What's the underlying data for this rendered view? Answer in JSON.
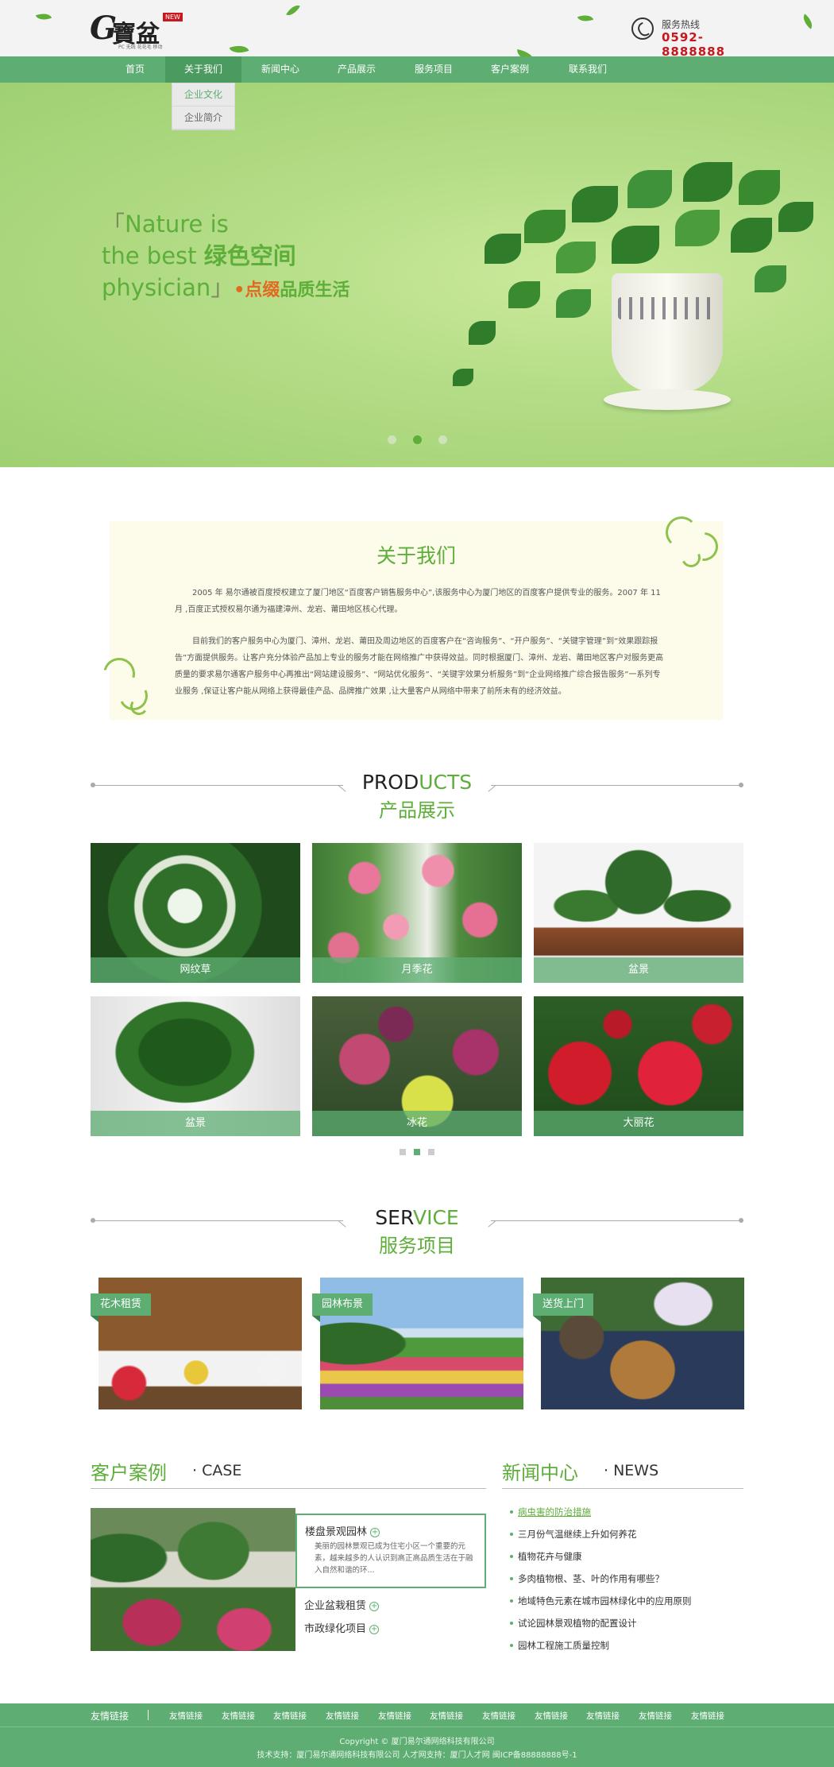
{
  "header": {
    "logo_letter": "G",
    "logo_cn": "寶盆",
    "logo_badge": "NEW",
    "logo_sub": "PC 无线 花花毛 移动",
    "hotline_label": "服务热线",
    "hotline_number": "0592-8888888"
  },
  "nav": {
    "items": [
      "首页",
      "关于我们",
      "新闻中心",
      "产品展示",
      "服务项目",
      "客户案例",
      "联系我们"
    ],
    "dropdown": [
      "企业文化",
      "企业简介"
    ]
  },
  "banner": {
    "line1": "Nature is",
    "line2_en": "the best ",
    "line2_cn": "绿色空间",
    "line3_en": "physician",
    "tag_dot": "•",
    "tag_orange": "点缀",
    "tag_green": "品质生活",
    "slides": 3,
    "active_slide": 2
  },
  "about": {
    "title": "关于我们",
    "p1": "2005 年 易尔通被百度授权建立了厦门地区“百度客户销售服务中心”,该服务中心为厦门地区的百度客户提供专业的服务。2007 年 11 月 ,百度正式授权易尔通为福建漳州、龙岩、莆田地区核心代理。",
    "p2": "目前我们的客户服务中心为厦门、漳州、龙岩、莆田及周边地区的百度客户在“咨询服务”、“开户服务”、“关键字管理”到“效果跟踪报告”方面提供服务。让客户充分体验产品加上专业的服务才能在网络推广中获得效益。同时根据厦门、漳州、龙岩、莆田地区客户对服务更高质量的要求易尔通客户服务中心再推出“网站建设服务”、“网站优化服务”、“关键字效果分析服务”到“企业网络推广综合报告服务”一系列专业服务 ,保证让客户能从网络上获得最佳产品、品牌推广效果 ,让大量客户从网络中带来了前所未有的经济效益。"
  },
  "products": {
    "title_en_a": "PROD",
    "title_en_b": "UCTS",
    "title_cn": "产品展示",
    "items": [
      "网纹草",
      "月季花",
      "盆景",
      "盆景",
      "冰花",
      "大丽花"
    ],
    "pages": 3,
    "active_page": 2
  },
  "services": {
    "title_en_a": "SER",
    "title_en_b": "VICE",
    "title_cn": "服务项目",
    "items": [
      "花木租赁",
      "园林布景",
      "送货上门"
    ]
  },
  "cases": {
    "title_cn": "客户案例",
    "title_en": "· CASE",
    "featured_title": "楼盘景观园林",
    "featured_desc": "美丽的园林景观已成为住宅小区一个重要的元素，越来越多的人认识到高正高品质生活在于融入自然和谐的环...",
    "links": [
      "企业盆栽租赁",
      "市政绿化项目"
    ],
    "plus": "+"
  },
  "news": {
    "title_cn": "新闻中心",
    "title_en": "· NEWS",
    "items": [
      "病虫害的防治措施",
      "三月份气温继续上升如何养花",
      "植物花卉与健康",
      "多肉植物根、茎、叶的作用有哪些？",
      "地域特色元素在城市园林绿化中的应用原则",
      "试论园林景观植物的配置设计",
      "园林工程施工质量控制"
    ]
  },
  "footer": {
    "links_label": "友情链接",
    "links": [
      "友情链接",
      "友情链接",
      "友情链接",
      "友情链接",
      "友情链接",
      "友情链接",
      "友情链接",
      "友情链接",
      "友情链接",
      "友情链接",
      "友情链接"
    ],
    "copyright": "Copyright © 厦门易尔通网络科技有限公司",
    "tech": "技术支持：厦门易尔通网络科技有限公司 人才网支持：厦门人才网 闽ICP备88888888号-1"
  },
  "colors": {
    "brand_green": "#5eae73",
    "text_green": "#5eae3a",
    "accent_orange": "#e26a1f",
    "hotline_red": "#c8171e"
  }
}
